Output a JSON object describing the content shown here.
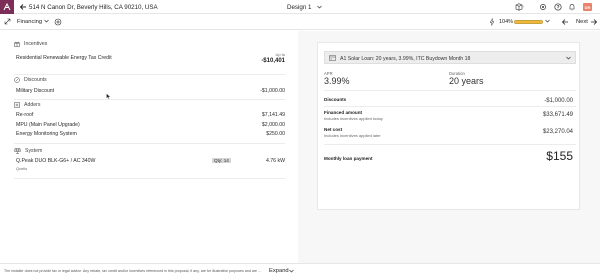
{
  "header": {
    "address": "514 N Canon Dr, Beverly Hills, CA 90210, USA",
    "design": "Design 1",
    "avatar": "DR"
  },
  "subheader": {
    "section": "Financing",
    "percent": "104%",
    "progress": 1.0,
    "next": "Next"
  },
  "incentives": {
    "title": "Incentives",
    "item_label": "Residential Renewable Energy Tax Credit",
    "up_to": "Up to",
    "item_value": "-$10,401"
  },
  "discounts": {
    "title": "Discounts",
    "item_label": "Military Discount",
    "item_value": "-$1,000.00"
  },
  "adders": {
    "title": "Adders",
    "items": [
      {
        "label": "Re-roof",
        "value": "$7,141.49"
      },
      {
        "label": "MPU (Main Panel Upgrade)",
        "value": "$2,000.00"
      },
      {
        "label": "Energy Monitoring System",
        "value": "$250.00"
      }
    ]
  },
  "system": {
    "title": "System",
    "module": "Q.Peak DUO BLK-G6+ / AC 340W",
    "brand": "Qcells",
    "qty": "Qty: 14",
    "size": "4.76 kW"
  },
  "summary": {
    "loan": "A1 Solar Loan: 20 years, 3.99%, ITC Buydown Month 18",
    "apr_label": "APR",
    "apr_value": "3.99%",
    "duration_label": "Duration",
    "duration_value": "20 years",
    "discounts_label": "Discounts",
    "discounts_value": "-$1,000.00",
    "financed_label": "Financed amount",
    "financed_sub": "Includes incentives applied today",
    "financed_value": "$33,671.49",
    "net_label": "Net cost",
    "net_sub": "Includes incentives applied later",
    "net_value": "$23,270.04",
    "monthly_label": "Monthly loan payment",
    "monthly_value": "$155"
  },
  "footer": {
    "disclaimer": "The installer does not provide tax or legal advice. Any rebate, tax credit and/or incentives referenced in this proposal, if any, are for illustrative purposes and are not a guarant...",
    "expand": "Expand"
  }
}
